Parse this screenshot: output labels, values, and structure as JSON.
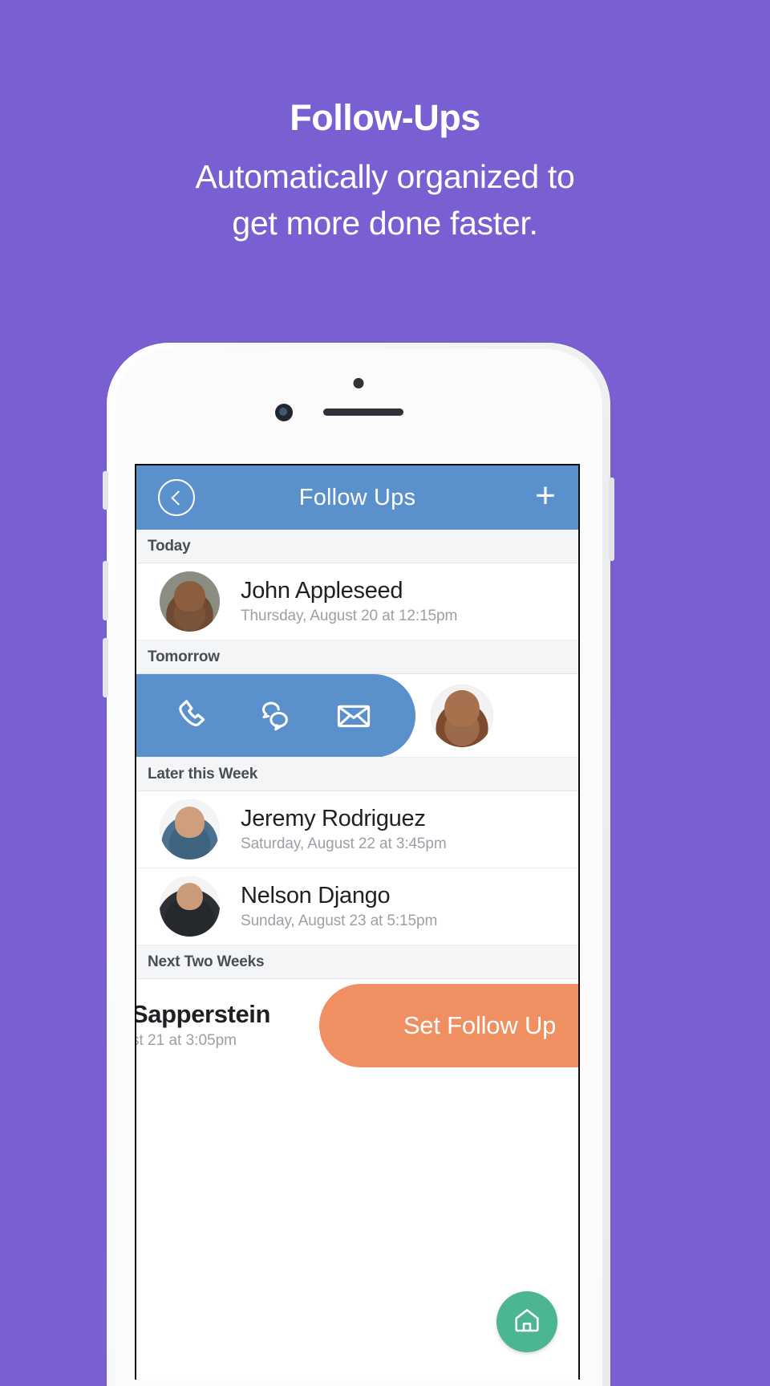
{
  "promo": {
    "title": "Follow-Ups",
    "subtitle_line1": "Automatically organized to",
    "subtitle_line2": "get more done faster."
  },
  "theme": {
    "background": "#7a5fd3",
    "app_header_blue": "#5a90cc",
    "cta_orange": "#f08f62",
    "fab_green": "#4cb593",
    "section_header_bg": "#f4f5f7"
  },
  "app": {
    "header": {
      "title": "Follow Ups",
      "back_icon": "chevron-left-icon",
      "add_icon": "plus-icon"
    },
    "sections": [
      {
        "label": "Today",
        "rows": [
          {
            "name": "John Appleseed",
            "date": "Thursday, August 20 at 12:15pm",
            "avatar": "john-appleseed-avatar"
          }
        ]
      },
      {
        "label": "Tomorrow",
        "swiped_row": {
          "actions": [
            {
              "icon": "phone-icon",
              "label": "Call"
            },
            {
              "icon": "chat-bubbles-icon",
              "label": "Message"
            },
            {
              "icon": "envelope-icon",
              "label": "Email"
            }
          ],
          "avatar": "contact-avatar"
        }
      },
      {
        "label": "Later this Week",
        "rows": [
          {
            "name": "Jeremy Rodriguez",
            "date": "Saturday, August 22 at 3:45pm",
            "avatar": "jeremy-rodriguez-avatar"
          },
          {
            "name": "Nelson Django",
            "date": "Sunday, August 23 at 5:15pm",
            "avatar": "nelson-django-avatar"
          }
        ]
      },
      {
        "label": "Next Two Weeks",
        "shifted_row": {
          "name": "Sapperstein",
          "date": "st 21 at 3:05pm",
          "cta_label": "Set Follow Up"
        }
      }
    ],
    "fab": {
      "icon": "home-icon"
    }
  }
}
